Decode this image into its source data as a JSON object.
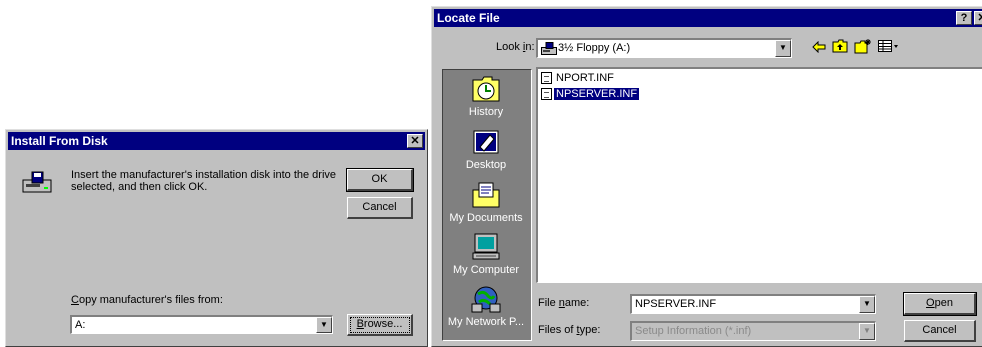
{
  "install_dialog": {
    "title": "Install From Disk",
    "close_glyph": "✕",
    "message": "Insert the manufacturer's installation disk into the drive selected, and then click OK.",
    "ok_label": "OK",
    "cancel_label": "Cancel",
    "copy_label_pre": "",
    "copy_label_u": "C",
    "copy_label_post": "opy manufacturer's files from:",
    "copy_value": "A:",
    "browse_pre": "",
    "browse_u": "B",
    "browse_post": "rowse..."
  },
  "locate_dialog": {
    "title": "Locate File",
    "help_glyph": "?",
    "close_glyph": "✕",
    "lookin_label_pre": "Look ",
    "lookin_label_u": "i",
    "lookin_label_post": "n:",
    "lookin_value": "3½ Floppy (A:)",
    "toolbar": [
      "back-icon",
      "up-folder-icon",
      "new-folder-icon",
      "view-menu-icon"
    ],
    "places": [
      {
        "label": "History",
        "icon": "history-icon"
      },
      {
        "label": "Desktop",
        "icon": "desktop-icon"
      },
      {
        "label": "My Documents",
        "icon": "my-documents-icon"
      },
      {
        "label": "My Computer",
        "icon": "my-computer-icon"
      },
      {
        "label": "My Network P...",
        "icon": "my-network-icon"
      }
    ],
    "files": [
      {
        "name": "NPORT.INF",
        "selected": false
      },
      {
        "name": "NPSERVER.INF",
        "selected": true
      }
    ],
    "filename_label_pre": "File ",
    "filename_label_u": "n",
    "filename_label_post": "ame:",
    "filename_value": "NPSERVER.INF",
    "filetype_label_pre": "Files of ",
    "filetype_label_u": "t",
    "filetype_label_post": "ype:",
    "filetype_value": "Setup Information (*.inf)",
    "open_pre": "",
    "open_u": "O",
    "open_post": "pen",
    "cancel_label": "Cancel"
  }
}
